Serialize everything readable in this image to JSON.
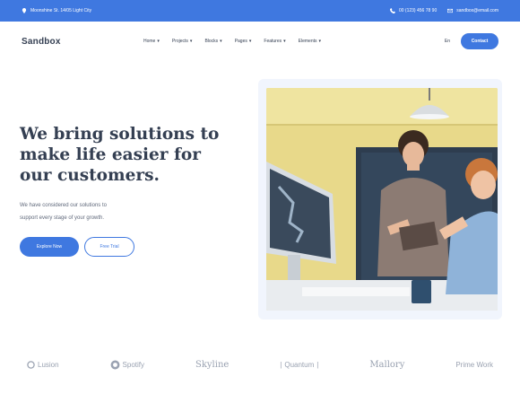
{
  "topbar": {
    "address": "Moonshine St. 14/05 Light City",
    "phone": "00 (123) 456 78 90",
    "email": "sandbox@email.com"
  },
  "navbar": {
    "logo": "Sandbox",
    "menu": [
      {
        "label": "Home"
      },
      {
        "label": "Projects"
      },
      {
        "label": "Blocks"
      },
      {
        "label": "Pages"
      },
      {
        "label": "Features"
      },
      {
        "label": "Elements"
      }
    ],
    "language": "En",
    "contact": "Contact"
  },
  "hero": {
    "title_line1": "We bring solutions to",
    "title_line2": "make life easier for",
    "title_line3": "our customers.",
    "subtitle_line1": "We have considered our solutions to",
    "subtitle_line2": "support every stage of your growth.",
    "primary_button": "Explore Now",
    "secondary_button": "Free Trial"
  },
  "clients": [
    "Lusion",
    "Spotify",
    "Skyline",
    "Quantum",
    "Mallory",
    "Prime Work"
  ],
  "colors": {
    "accent": "#3f78e0",
    "text": "#343f52",
    "muted": "#60697b",
    "logo_gray": "#9aa2b1"
  }
}
